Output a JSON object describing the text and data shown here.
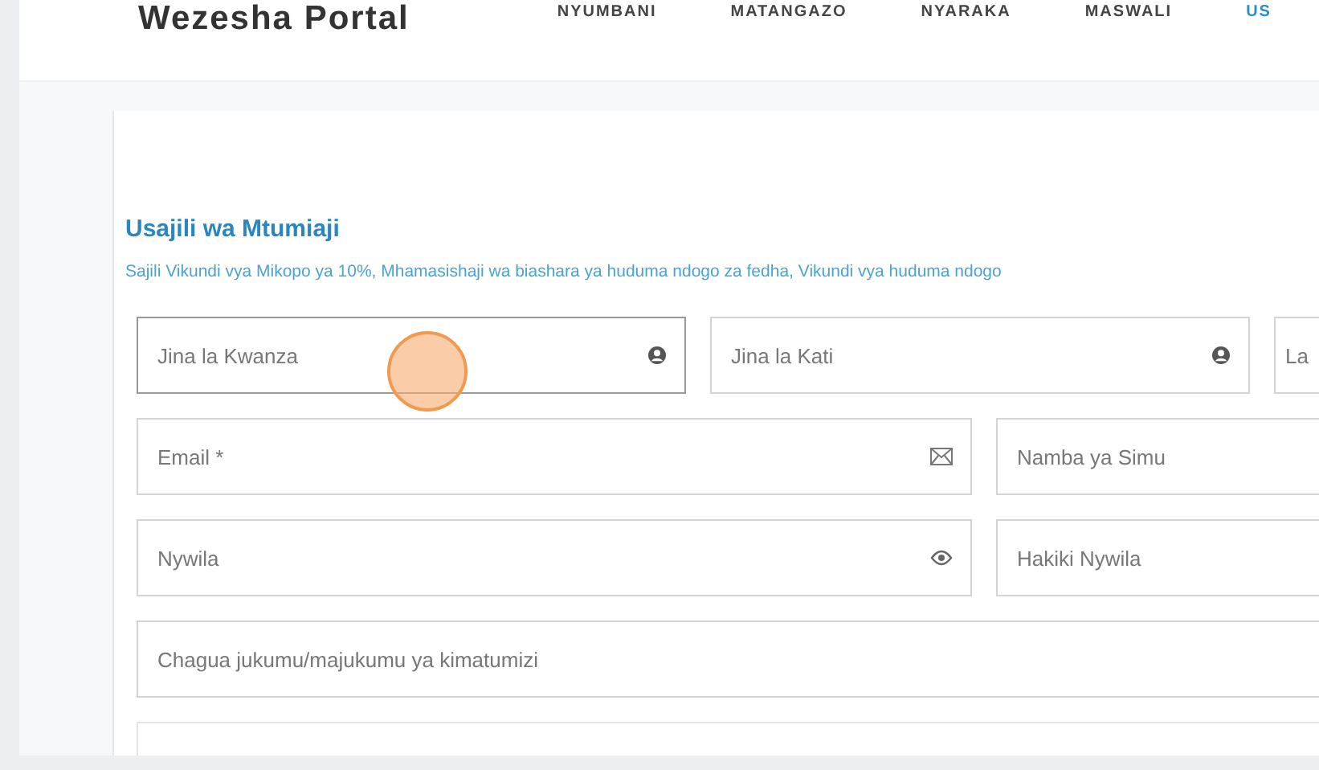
{
  "header": {
    "brand": "Wezesha Portal",
    "nav": [
      {
        "label": "NYUMBANI",
        "selected": false
      },
      {
        "label": "MATANGAZO",
        "selected": false
      },
      {
        "label": "NYARAKA",
        "selected": false
      },
      {
        "label": "MASWALI",
        "selected": false
      },
      {
        "label": "US",
        "selected": true
      }
    ]
  },
  "form": {
    "title": "Usajili wa Mtumiaji",
    "subtitle": "Sajili Vikundi vya Mikopo ya 10%, Mhamasishaji wa biashara ya huduma ndogo za fedha, Vikundi vya huduma ndogo",
    "rows": [
      {
        "fields": [
          {
            "placeholder": "Jina la Kwanza",
            "focused": true,
            "kind": "name"
          },
          {
            "placeholder": "Jina la Kati",
            "focused": false,
            "kind": "name"
          },
          {
            "placeholder": "La",
            "focused": false,
            "kind": "text"
          }
        ]
      },
      {
        "fields": [
          {
            "placeholder": "Email *",
            "focused": false,
            "kind": "email"
          },
          {
            "placeholder": "Namba ya Simu",
            "focused": false,
            "kind": "text"
          }
        ]
      },
      {
        "fields": [
          {
            "placeholder": "Nywila",
            "focused": false,
            "kind": "password"
          },
          {
            "placeholder": "Hakiki Nywila",
            "focused": false,
            "kind": "text"
          }
        ]
      },
      {
        "fields": [
          {
            "placeholder": "Chagua jukumu/majukumu ya kimatumizi",
            "focused": false,
            "kind": "text"
          }
        ]
      }
    ]
  }
}
